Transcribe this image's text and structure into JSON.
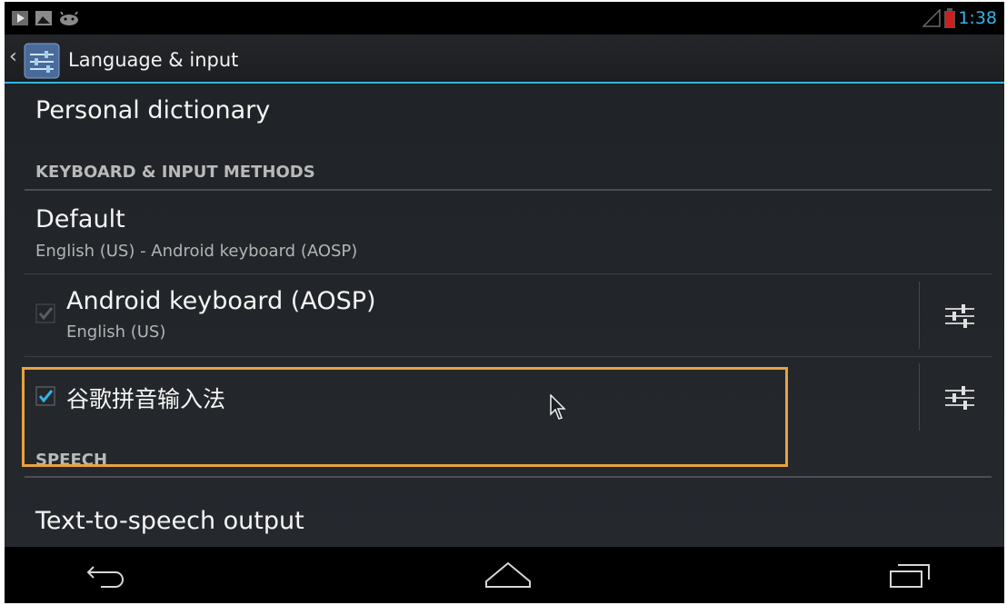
{
  "status_bar": {
    "time": "1:38",
    "icons": [
      "play-store-notification-icon",
      "image-notification-icon",
      "android-debug-icon",
      "signal-icon",
      "battery-low-icon"
    ]
  },
  "action_bar": {
    "title": "Language & input",
    "icon": "settings-sliders-icon"
  },
  "list": {
    "personal_dictionary": {
      "title": "Personal dictionary"
    },
    "keyboard_header": "KEYBOARD & INPUT METHODS",
    "default": {
      "title": "Default",
      "summary": "English (US) - Android keyboard (AOSP)"
    },
    "android_keyboard": {
      "title": "Android keyboard (AOSP)",
      "summary": "English (US)",
      "checked": true,
      "enabled": false
    },
    "google_pinyin": {
      "title": "谷歌拼音输入法",
      "checked": true,
      "enabled": true
    },
    "speech_header": "SPEECH",
    "tts": {
      "title": "Text-to-speech output"
    }
  },
  "colors": {
    "accent": "#33b5e5",
    "highlight": "#e8a240",
    "background": "#22262a"
  },
  "nav_bar": {
    "buttons": [
      "back-icon",
      "home-icon",
      "recent-apps-icon"
    ]
  }
}
